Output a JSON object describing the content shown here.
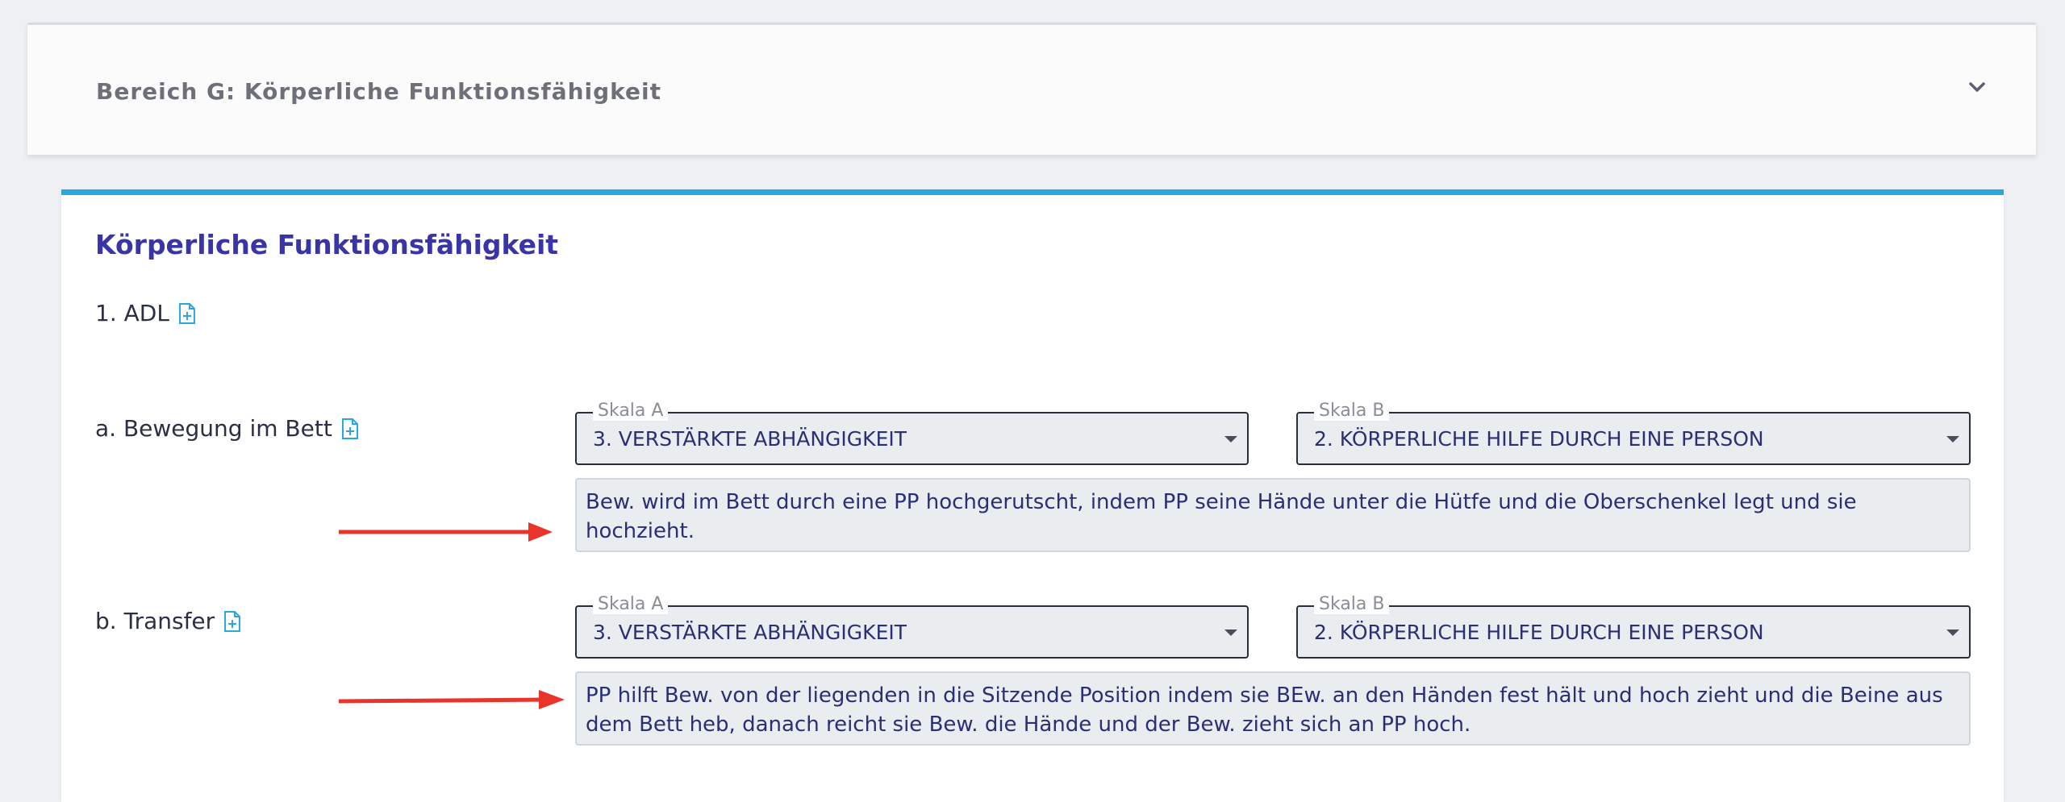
{
  "accordion": {
    "title": "Bereich G: Körperliche Funktionsfähigkeit"
  },
  "section": {
    "title": "Körperliche Funktionsfähigkeit",
    "adl_heading": "1. ADL"
  },
  "items": [
    {
      "label": "a. Bewegung im Bett",
      "skala_a_label": "Skala A",
      "skala_a_value": "3. VERSTÄRKTE ABHÄNGIGKEIT",
      "skala_b_label": "Skala B",
      "skala_b_value": "2. KÖRPERLICHE HILFE DURCH EINE PERSON",
      "note": "Bew. wird im Bett durch eine PP hochgerutscht, indem PP seine Hände unter die Hütfe und die Oberschenkel legt und sie hochzieht."
    },
    {
      "label": "b. Transfer",
      "skala_a_label": "Skala A",
      "skala_a_value": "3. VERSTÄRKTE ABHÄNGIGKEIT",
      "skala_b_label": "Skala B",
      "skala_b_value": "2. KÖRPERLICHE HILFE DURCH EINE PERSON",
      "note": "PP hilft Bew. von der liegenden in die Sitzende Position indem sie BEw. an den Händen fest hält und hoch zieht und die Beine aus dem Bett heb, danach reicht sie Bew. die Hände und der Bew. zieht sich an PP hoch."
    }
  ],
  "colors": {
    "accent_blue": "#2aa7de",
    "title_purple": "#3935a6",
    "annotation_red": "#e8342a"
  }
}
